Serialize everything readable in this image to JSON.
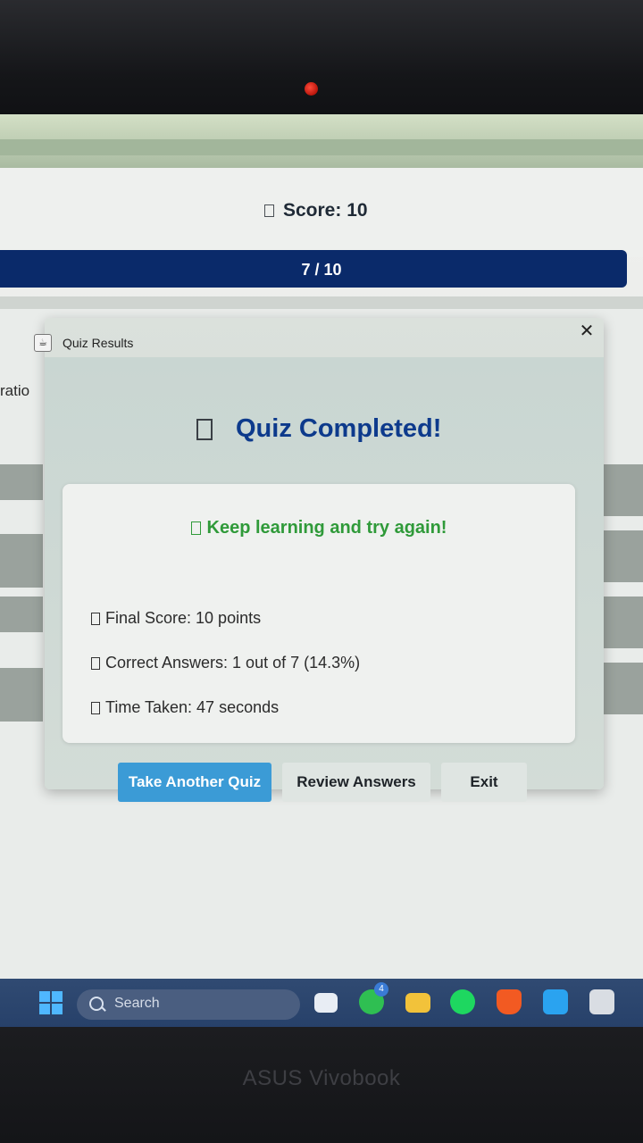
{
  "app": {
    "score_label": "Score: 10",
    "progress_label": "7 / 10",
    "side_text": "ratio"
  },
  "dialog": {
    "title": "Quiz Results",
    "close_glyph": "✕",
    "heading": "Quiz Completed!",
    "message": "Keep learning and try again!",
    "stats": [
      "Final Score: 10 points",
      "Correct Answers: 1 out of 7 (14.3%)",
      "Time Taken: 47 seconds"
    ],
    "buttons": {
      "take_another": "Take Another Quiz",
      "review": "Review Answers",
      "exit": "Exit"
    }
  },
  "taskbar": {
    "search_placeholder": "Search",
    "whatsapp_badge": "4"
  },
  "device": {
    "brand": "ASUS Vivobook"
  },
  "colors": {
    "heading": "#0d3a8c",
    "message": "#2f9a39",
    "primary_button": "#3b9bd6",
    "progress_bar": "#0a2a6a"
  }
}
